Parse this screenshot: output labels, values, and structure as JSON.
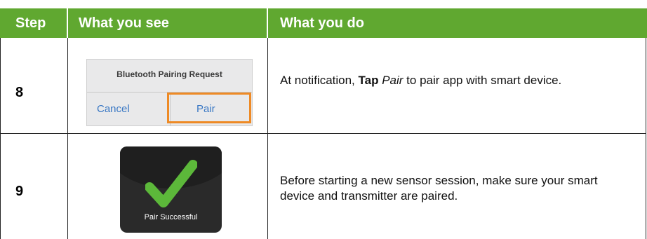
{
  "header": {
    "step": "Step",
    "what_you_see": "What you see",
    "what_you_do": "What you do"
  },
  "rows": [
    {
      "step": "8",
      "dialog": {
        "title": "Bluetooth Pairing Request",
        "cancel": "Cancel",
        "pair": "Pair"
      },
      "desc_pre": "At notification, ",
      "desc_bold": "Tap",
      "desc_space": " ",
      "desc_italic": "Pair",
      "desc_post": " to pair app with smart device."
    },
    {
      "step": "9",
      "image_caption": "Pair Successful",
      "desc": "Before starting a new sensor session, make sure your smart device and transmitter are paired."
    }
  ],
  "colors": {
    "header_bg": "#60a830",
    "header_text": "#ffffff",
    "highlight": "#ee8a25",
    "check_green": "#5cb83a"
  },
  "icons": [
    "checkmark-icon"
  ]
}
